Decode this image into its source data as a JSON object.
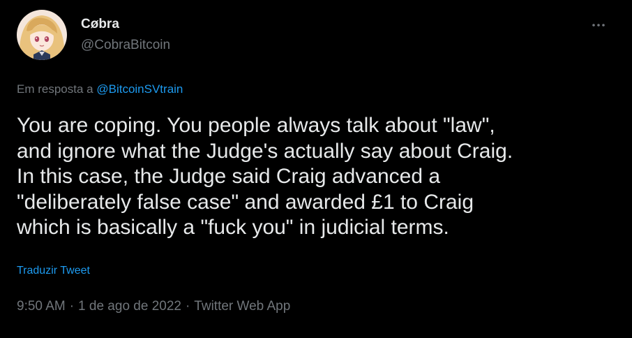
{
  "author": {
    "display_name": "Cøbra",
    "handle": "@CobraBitcoin",
    "avatar": "anime-girl-avatar"
  },
  "more_icon": "more-horizontal-icon",
  "reply": {
    "prefix": "Em resposta a",
    "mention": "@BitcoinSVtrain"
  },
  "tweet": {
    "lines": [
      "You are coping. You people always talk about \"law\",",
      "and ignore what the Judge's actually say about Craig.",
      "In this case, the Judge said Craig advanced a",
      "\"deliberately false case\" and awarded £1 to Craig",
      "which is basically a \"fuck you\" in judicial terms."
    ]
  },
  "translate_label": "Traduzir Tweet",
  "meta": {
    "time": "9:50 AM",
    "separator": "·",
    "date": "1 de ago de 2022",
    "source": "Twitter Web App"
  },
  "colors": {
    "background": "#000000",
    "text_primary": "#e7e9ea",
    "text_secondary": "#71767b",
    "accent": "#1d9bf0"
  }
}
